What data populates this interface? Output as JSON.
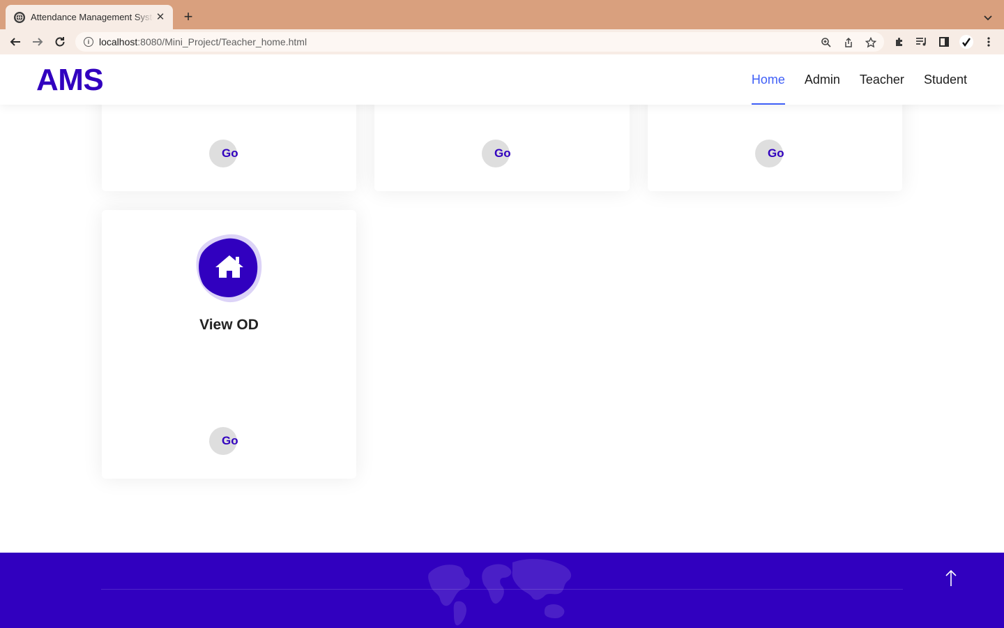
{
  "browser": {
    "tab_title": "Attendance Management System",
    "url_host": "localhost",
    "url_rest": ":8080/Mini_Project/Teacher_home.html"
  },
  "header": {
    "logo": "AMS",
    "nav": [
      {
        "label": "Home",
        "active": true
      },
      {
        "label": "Admin",
        "active": false
      },
      {
        "label": "Teacher",
        "active": false
      },
      {
        "label": "Student",
        "active": false
      }
    ]
  },
  "cards": [
    {
      "title": "",
      "go_label": "Go"
    },
    {
      "title": "",
      "go_label": "Go"
    },
    {
      "title": "",
      "go_label": "Go"
    },
    {
      "title": "View OD",
      "go_label": "Go",
      "icon": "house-icon"
    }
  ],
  "colors": {
    "brand": "#3100bf",
    "nav_active": "#3f5ff7",
    "tab_strip": "#d9a07e"
  }
}
